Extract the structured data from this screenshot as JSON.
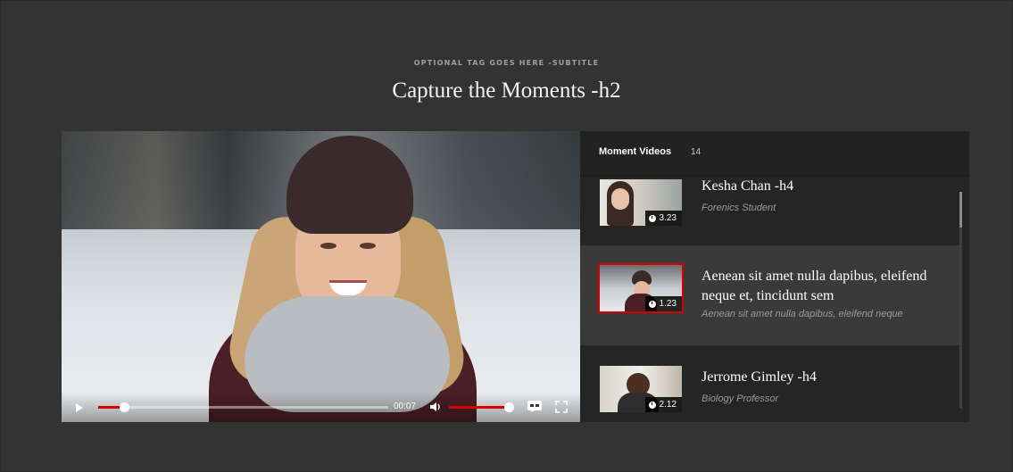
{
  "header": {
    "tag": "OPTIONAL TAG GOES HERE -SUBTITLE",
    "title": "Capture the Moments -h2"
  },
  "player": {
    "current_time": "00:07",
    "progress_fraction": 0.09,
    "volume_fraction": 0.95,
    "accent_color": "#d60000"
  },
  "playlist": {
    "title": "Moment Videos",
    "count": "14",
    "items": [
      {
        "title": "Kesha Chan -h4",
        "subtitle": "Forenics Student",
        "duration": "3.23",
        "selected": false
      },
      {
        "title": "Aenean sit amet nulla dapibus, eleifend neque et, tincidunt sem",
        "subtitle": "Aenean sit amet nulla dapibus, eleifend neque",
        "duration": "1.23",
        "selected": true
      },
      {
        "title": "Jerrome Gimley -h4",
        "subtitle": "Biology Professor",
        "duration": "2.12",
        "selected": false
      }
    ]
  },
  "icons": {
    "play": "play-icon",
    "volume": "volume-icon",
    "captions": "captions-icon",
    "fullscreen": "fullscreen-icon",
    "clock": "clock-icon"
  }
}
